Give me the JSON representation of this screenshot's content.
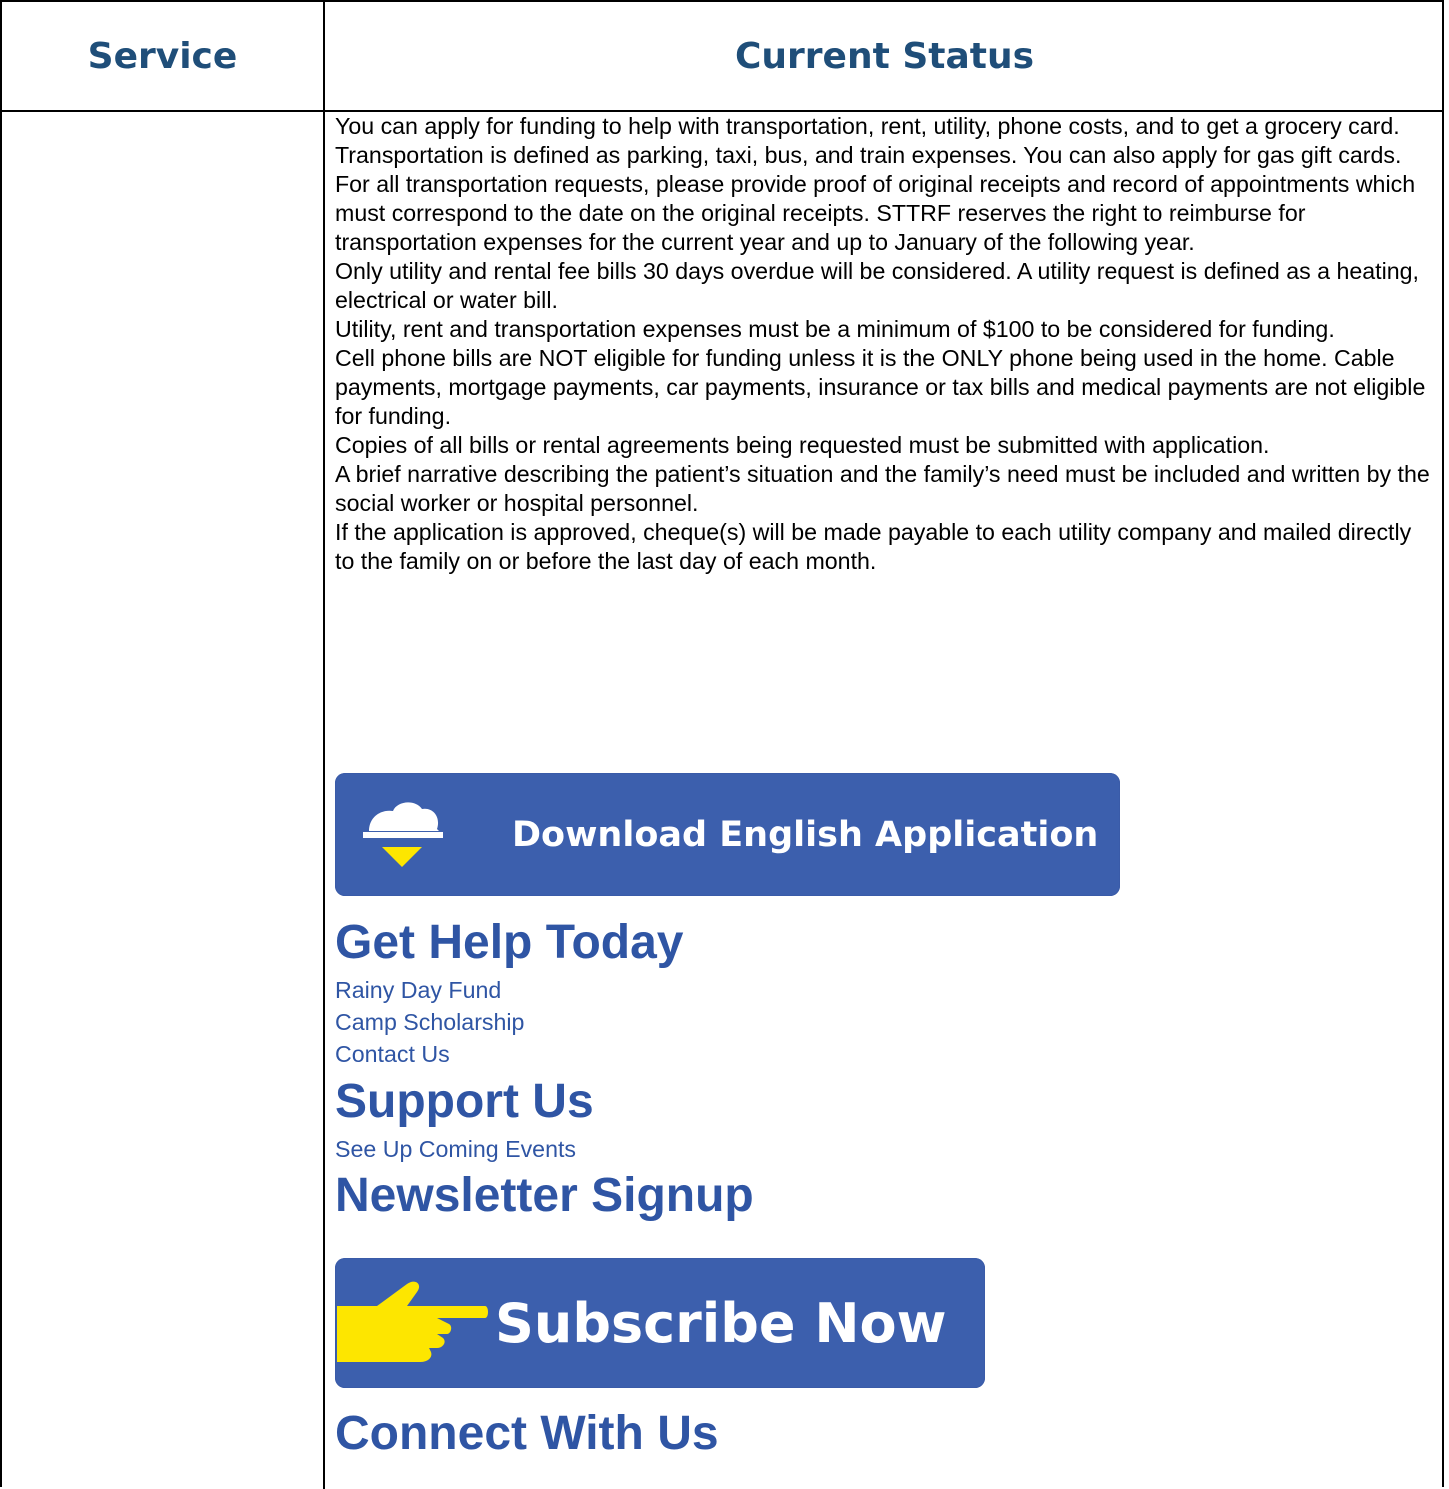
{
  "table": {
    "header_service": "Service",
    "header_status": "Current Status"
  },
  "paragraphs": [
    "You can apply for funding to help with transportation, rent, utility, phone costs, and to get a grocery card.",
    "Transportation is defined as parking, taxi, bus, and train expenses. You can also apply for gas gift cards. For all transportation requests, please provide proof of original receipts and record of appointments which must correspond to the date on the original receipts. STTRF reserves the right to reimburse for transportation expenses for the current year and up to January of the following year.",
    "Only utility and rental fee bills 30 days overdue will be considered. A utility request is defined as a heating, electrical or water bill.",
    "Utility, rent and transportation expenses must be a minimum of $100 to be considered for funding.",
    "Cell phone bills are NOT eligible for funding unless it is the ONLY phone being used in the home. Cable payments, mortgage payments, car payments, insurance or tax bills and medical payments are not eligible for funding.",
    "Copies of all bills or rental agreements being requested must be submitted with application.",
    "A brief narrative describing the patient’s situation and the family’s need must be included and written by the social worker or hospital personnel.",
    "If the application is approved, cheque(s) will be made payable to each utility company and mailed directly to the family on or before the last day of each month."
  ],
  "download_button": {
    "label": "Download English Application",
    "icon": "cloud-download-icon"
  },
  "get_help": {
    "heading": "Get Help Today",
    "links": [
      "Rainy Day Fund",
      "Camp Scholarship",
      "Contact Us"
    ]
  },
  "support": {
    "heading": "Support Us",
    "links": [
      "See Up Coming Events"
    ]
  },
  "newsletter": {
    "heading": "Newsletter Signup"
  },
  "subscribe_button": {
    "label": "Subscribe Now",
    "icon": "pointing-hand-icon"
  },
  "connect": {
    "heading": "Connect With Us"
  },
  "colors": {
    "header_text": "#1F4E79",
    "link_blue": "#2f55a4",
    "button_blue": "#3c5fad",
    "icon_yellow": "#fde600"
  }
}
